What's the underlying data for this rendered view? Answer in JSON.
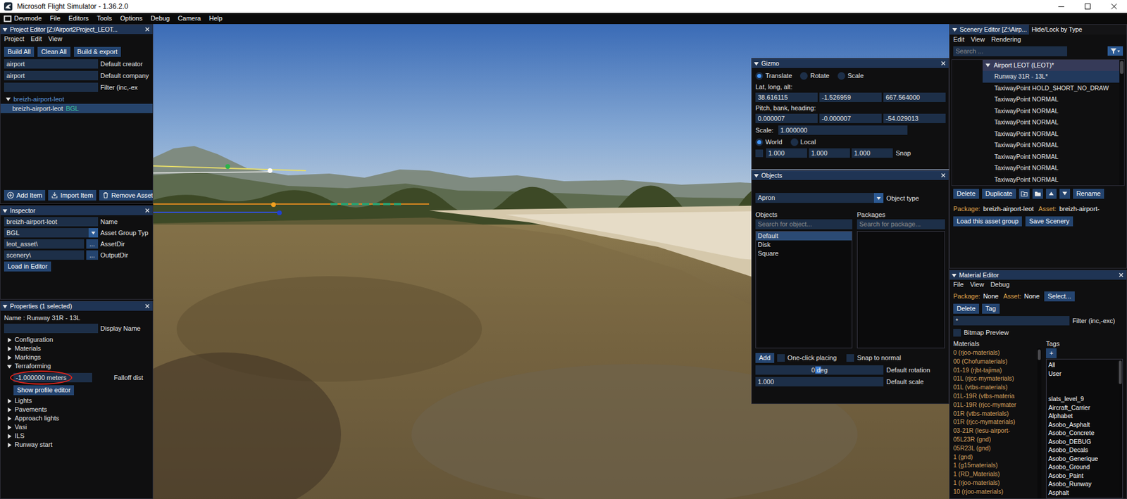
{
  "window": {
    "title": "Microsoft Flight Simulator - 1.36.2.0"
  },
  "menu_bar": [
    "Devmode",
    "File",
    "Editors",
    "Tools",
    "Options",
    "Debug",
    "Camera",
    "Help"
  ],
  "project_editor": {
    "title": "Project Editor [Z:/Airport2Project_LEOT...",
    "menu": [
      "Project",
      "Edit",
      "View"
    ],
    "buttons": [
      "Build All",
      "Clean All",
      "Build & export"
    ],
    "fields": [
      {
        "value": "airport",
        "label": "Default creator"
      },
      {
        "value": "airport",
        "label": "Default company"
      },
      {
        "value": "",
        "label": "Filter (inc,-ex"
      }
    ],
    "tree": {
      "label": "breizh-airport-leot",
      "expanded": true,
      "items": [
        {
          "label": "breizh-airport-leot",
          "badge": "BGL",
          "selected": true
        }
      ]
    },
    "footer_buttons": [
      "Add Item",
      "Import Item",
      "Remove Asset"
    ]
  },
  "inspector": {
    "title": "Inspector",
    "fields": [
      {
        "kind": "text",
        "value": "breizh-airport-leot",
        "label": "Name"
      },
      {
        "kind": "dropdown",
        "value": "BGL",
        "label": "Asset Group Typ"
      },
      {
        "kind": "path",
        "value": "leot_asset\\",
        "browse": "...",
        "label": "AssetDir"
      },
      {
        "kind": "path",
        "value": "scenery\\",
        "browse": "...",
        "label": "OutputDir"
      }
    ],
    "button": "Load in Editor"
  },
  "properties": {
    "title": "Properties (1 selected)",
    "name_line": "Name : Runway 31R - 13L",
    "display_name": {
      "value": "",
      "label": "Display Name"
    },
    "sections": [
      {
        "label": "Configuration",
        "expanded": false
      },
      {
        "label": "Materials",
        "expanded": false
      },
      {
        "label": "Markings",
        "expanded": false
      },
      {
        "label": "Terraforming",
        "expanded": true,
        "field": {
          "value": "-1.000000 meters",
          "label": "Falloff dist",
          "circled": true
        },
        "button": "Show profile editor"
      },
      {
        "label": "Lights",
        "expanded": false
      },
      {
        "label": "Pavements",
        "expanded": false
      },
      {
        "label": "Approach lights",
        "expanded": false
      },
      {
        "label": "Vasi",
        "expanded": false
      },
      {
        "label": "ILS",
        "expanded": false
      },
      {
        "label": "Runway start",
        "expanded": false
      }
    ]
  },
  "gizmo": {
    "title": "Gizmo",
    "modes": [
      {
        "label": "Translate",
        "selected": true
      },
      {
        "label": "Rotate",
        "selected": false
      },
      {
        "label": "Scale",
        "selected": false
      }
    ],
    "position": {
      "label": "Lat, long, alt:",
      "values": [
        "38.616115",
        "-1.526959",
        "667.564000"
      ]
    },
    "rotation": {
      "label": "Pitch, bank, heading:",
      "values": [
        "0.000007",
        "-0.000007",
        "-54.029013"
      ]
    },
    "scale": {
      "label": "Scale:",
      "value": "1.000000"
    },
    "spaces": [
      {
        "label": "World",
        "selected": true
      },
      {
        "label": "Local",
        "selected": false
      }
    ],
    "snap": {
      "checked": false,
      "values": [
        "1.000",
        "1.000",
        "1.000"
      ],
      "label": "Snap"
    }
  },
  "objects": {
    "title": "Objects",
    "type": {
      "value": "Apron",
      "label": "Object type"
    },
    "objects_header": "Objects",
    "packages_header": "Packages",
    "object_search": {
      "placeholder": "Search for object..."
    },
    "package_search": {
      "placeholder": "Search for package..."
    },
    "object_list": [
      {
        "label": "Default",
        "selected": true
      },
      {
        "label": "Disk",
        "selected": false
      },
      {
        "label": "Square",
        "selected": false
      }
    ],
    "add": "Add",
    "one_click": {
      "label": "One-click placing",
      "checked": false
    },
    "snap_normal": {
      "label": "Snap to normal",
      "checked": false
    },
    "rotation": {
      "reading": "0 deg",
      "level": 0.49,
      "label": "Default rotation"
    },
    "scale": {
      "value": "1.000",
      "label": "Default scale"
    }
  },
  "scenery_editor": {
    "tabs": [
      {
        "label": "Scenery Editor [Z:\\Airp...",
        "selected": true
      },
      {
        "label": "Hide/Lock by Type",
        "selected": false
      }
    ],
    "menu": [
      "Edit",
      "View",
      "Rendering"
    ],
    "search": {
      "placeholder": "Search ..."
    },
    "tree": {
      "label": "Airport LEOT (LEOT)*",
      "expanded": true,
      "hovered": true,
      "items": [
        {
          "label": "Runway 31R - 13L*",
          "selected": true
        },
        {
          "label": "TaxiwayPoint HOLD_SHORT_NO_DRAW",
          "selected": false
        },
        {
          "label": "TaxiwayPoint NORMAL",
          "selected": false
        },
        {
          "label": "TaxiwayPoint NORMAL",
          "selected": false
        },
        {
          "label": "TaxiwayPoint NORMAL",
          "selected": false
        },
        {
          "label": "TaxiwayPoint NORMAL",
          "selected": false
        },
        {
          "label": "TaxiwayPoint NORMAL",
          "selected": false
        },
        {
          "label": "TaxiwayPoint NORMAL",
          "selected": false
        },
        {
          "label": "TaxiwayPoint NORMAL",
          "selected": false
        },
        {
          "label": "TaxiwayPoint NORMAL",
          "selected": false
        }
      ]
    },
    "buttons": [
      "Delete",
      "Duplicate"
    ],
    "rename": "Rename",
    "package_info": {
      "package_label": "Package:",
      "package": "breizh-airport-leot",
      "asset_label": "Asset:",
      "asset": "breizh-airport-"
    },
    "actions": [
      "Load this asset group",
      "Save Scenery"
    ]
  },
  "material_editor": {
    "title": "Material Editor",
    "menu": [
      "File",
      "View",
      "Debug"
    ],
    "package_label": "Package:",
    "package": "None",
    "asset_label": "Asset:",
    "asset": "None",
    "select": "Select...",
    "buttons": [
      "Delete",
      "Tag"
    ],
    "filter": {
      "value": "*",
      "label": "Filter (inc,-exc)"
    },
    "bitmap_preview": {
      "label": "Bitmap Preview",
      "checked": false
    },
    "materials_header": "Materials",
    "materials": [
      "0 (rjoo-materials)",
      "00 (Chofumaterials)",
      "01-19 (rjbt-tajima)",
      "01L (rjcc-mymaterials)",
      "01L (vtbs-materials)",
      "01L-19R (vtbs-materia",
      "01L-19R (rjcc-mymater",
      "01R (vtbs-materials)",
      "01R (rjcc-mymaterials)",
      "03-21R (lesu-airport-",
      "05L23R (gnd)",
      "05R23L (gnd)",
      "1 (gnd)",
      "1 (g15materials)",
      "1 (RD_Materials)",
      "1 (rjoo-materials)",
      "10 (rjoo-materials)"
    ],
    "tags_header": "Tags",
    "add_tag": "+",
    "tags": [
      "All",
      "User",
      "",
      "",
      "slats_level_9",
      "Aircraft_Carrier",
      "Alphabet",
      "Asobo_Asphalt",
      "Asobo_Concrete",
      "Asobo_DEBUG",
      "Asobo_Decals",
      "Asobo_Generique",
      "Asobo_Ground",
      "Asobo_Paint",
      "Asobo_Runway",
      "Asphalt"
    ]
  }
}
